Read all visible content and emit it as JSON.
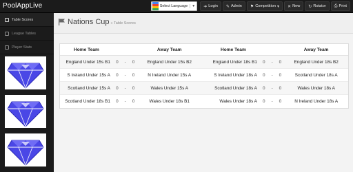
{
  "navbar": {
    "brand": "PoolAppLive",
    "language_label": "Select Language",
    "buttons": [
      {
        "label": "Login",
        "icon": "login-icon"
      },
      {
        "label": "Admin",
        "icon": "admin-icon"
      },
      {
        "label": "Competition",
        "icon": "competition-icon"
      },
      {
        "label": "New",
        "icon": "new-icon"
      },
      {
        "label": "Rotator",
        "icon": "rotator-icon"
      },
      {
        "label": "Print",
        "icon": "print-icon"
      }
    ]
  },
  "sidebar": {
    "items": [
      {
        "label": "Table Scores",
        "active": true
      },
      {
        "label": "League Tables",
        "active": false
      },
      {
        "label": "Player Stats",
        "active": false
      }
    ]
  },
  "page": {
    "title": "Nations Cup",
    "subtitle": "» Table Scores"
  },
  "table": {
    "headers": {
      "home": "Home Team",
      "away": "Away Team"
    },
    "left": [
      {
        "home": "England Under 15s B1",
        "hs": "0",
        "dash": "-",
        "as": "0",
        "away": "England Under 15s B2"
      },
      {
        "home": "S Ireland Under 15s A",
        "hs": "0",
        "dash": "-",
        "as": "0",
        "away": "N Ireland Under 15s A"
      },
      {
        "home": "Scotland Under 15s A",
        "hs": "0",
        "dash": "-",
        "as": "0",
        "away": "Wales Under 15s A"
      },
      {
        "home": "Scotland Under 18s B1",
        "hs": "0",
        "dash": "-",
        "as": "0",
        "away": "Wales Under 18s B1"
      }
    ],
    "right": [
      {
        "home": "England Under 18s B1",
        "hs": "0",
        "dash": "-",
        "as": "0",
        "away": "England Under 18s B2"
      },
      {
        "home": "S Ireland Under 18s A",
        "hs": "0",
        "dash": "-",
        "as": "0",
        "away": "Scotland Under 18s A"
      },
      {
        "home": "Scotland Under 18s A",
        "hs": "0",
        "dash": "-",
        "as": "0",
        "away": "Wales Under 18s A"
      },
      {
        "home": "Wales Under 18s A",
        "hs": "0",
        "dash": "-",
        "as": "0",
        "away": "N Ireland Under 18s A"
      }
    ]
  },
  "colors": {
    "navbar": "#1b1b1b",
    "ad_diamond": "#4a47e6"
  }
}
